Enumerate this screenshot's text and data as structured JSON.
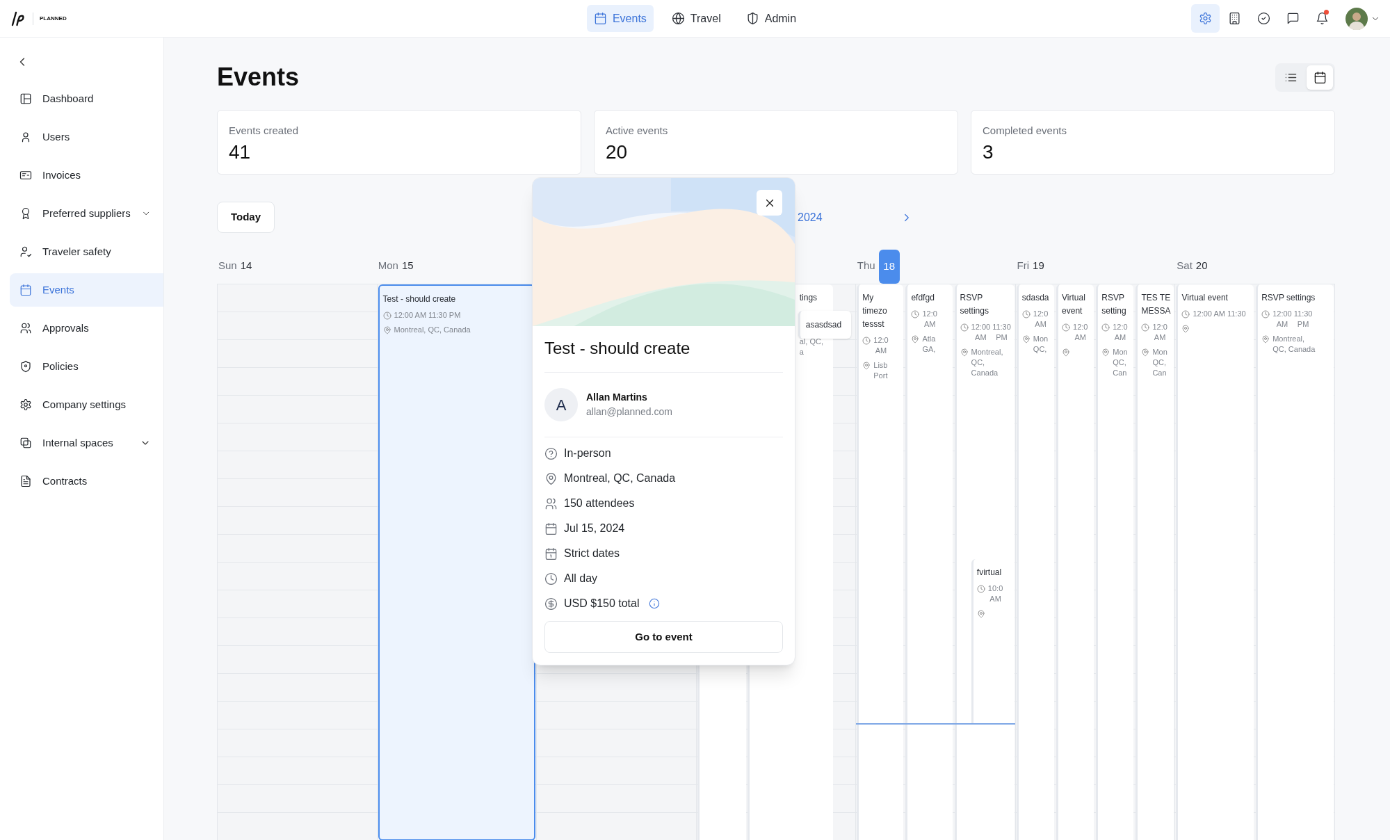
{
  "brand": {
    "wordmark": "PLANNED"
  },
  "top_nav": [
    {
      "label": "Events",
      "selected": true
    },
    {
      "label": "Travel",
      "selected": false
    },
    {
      "label": "Admin",
      "selected": false
    }
  ],
  "header_icons": [
    {
      "selected": true
    },
    {
      "selected": false
    },
    {
      "selected": false
    },
    {
      "selected": false
    },
    {
      "selected": false,
      "badge": true
    }
  ],
  "sidebar": {
    "items": [
      {
        "label": "Dashboard",
        "selected": false
      },
      {
        "label": "Users",
        "selected": false
      },
      {
        "label": "Invoices",
        "selected": false
      },
      {
        "label": "Preferred suppliers",
        "selected": false,
        "expandable": true
      },
      {
        "label": "Traveler safety",
        "selected": false
      },
      {
        "label": "Events",
        "selected": true
      },
      {
        "label": "Approvals",
        "selected": false
      },
      {
        "label": "Policies",
        "selected": false
      },
      {
        "label": "Company settings",
        "selected": false
      },
      {
        "label": "Internal spaces",
        "selected": false,
        "expandable": true
      },
      {
        "label": "Contracts",
        "selected": false
      }
    ]
  },
  "page": {
    "title": "Events",
    "views": [
      {
        "selected": false
      },
      {
        "selected": true
      }
    ]
  },
  "stats": [
    {
      "label": "Events created",
      "value": "41"
    },
    {
      "label": "Active events",
      "value": "20"
    },
    {
      "label": "Completed events",
      "value": "3"
    }
  ],
  "calendar": {
    "today_button": "Today",
    "range": "2024",
    "days": [
      {
        "kind": "day",
        "weekday": "Sun",
        "date": "14",
        "today": false
      },
      {
        "kind": "day",
        "weekday": "Mon",
        "date": "15",
        "today": false,
        "events": [
          {
            "kind": "allday",
            "selected": true,
            "title": [
              "Test - should create"
            ],
            "time": [
              [
                "12:00 AM"
              ],
              [
                "11:30 PM"
              ]
            ],
            "location": [
              "Montreal, QC, Canada"
            ]
          }
        ]
      },
      {
        "kind": "blank"
      },
      {
        "kind": "blank",
        "events": [
          {
            "kind": "covered",
            "selected": false
          },
          {
            "kind": "partial",
            "selected": false,
            "title": [
              "tings"
            ],
            "location": [
              "al, QC,",
              "a"
            ]
          },
          {
            "kind": "overlay",
            "selected": false,
            "title": [
              "asasdsad"
            ]
          }
        ]
      },
      {
        "kind": "day",
        "weekday": "Thu",
        "date": "18",
        "today": true,
        "events": [
          {
            "kind": "allday",
            "selected": false,
            "title": [
              "My",
              "timezo",
              "tessst"
            ],
            "time": [
              [
                "12:0",
                "AM"
              ]
            ],
            "location": [
              "Lisb",
              "Port"
            ]
          },
          {
            "kind": "allday",
            "selected": false,
            "title": [
              "efdfgd"
            ],
            "time": [
              [
                "12:0",
                "AM"
              ]
            ],
            "location": [
              "Atla",
              "GA,"
            ]
          },
          {
            "kind": "allday",
            "selected": false,
            "title": [
              "RSVP",
              "settings"
            ],
            "time": [
              [
                "12:00",
                "AM"
              ],
              [
                "11:30",
                "PM"
              ]
            ],
            "location": [
              "Montreal,",
              "QC,",
              "Canada"
            ]
          },
          {
            "kind": "timed",
            "selected": false,
            "title": [
              "fvirtual"
            ],
            "time": [
              [
                "10:0",
                "AM"
              ]
            ],
            "pin": true
          }
        ]
      },
      {
        "kind": "day",
        "weekday": "Fri",
        "date": "19",
        "today": false,
        "events": [
          {
            "kind": "allday",
            "selected": false,
            "title": [
              "sdasda"
            ],
            "time": [
              [
                "12:0",
                "AM"
              ]
            ],
            "location": [
              "Mon",
              "QC,"
            ]
          },
          {
            "kind": "allday",
            "selected": false,
            "title": [
              "Virtual",
              "event"
            ],
            "time": [
              [
                "12:0",
                "AM"
              ]
            ],
            "pin": true
          },
          {
            "kind": "allday",
            "selected": false,
            "title": [
              "RSVP",
              "setting"
            ],
            "time": [
              [
                "12:0",
                "AM"
              ]
            ],
            "location": [
              "Mon",
              "QC,",
              "Can"
            ]
          },
          {
            "kind": "allday",
            "selected": false,
            "title": [
              "TES TE",
              "MESSA"
            ],
            "time": [
              [
                "12:0",
                "AM"
              ]
            ],
            "location": [
              "Mon",
              "QC,",
              "Can"
            ]
          }
        ]
      },
      {
        "kind": "day",
        "weekday": "Sat",
        "date": "20",
        "today": false,
        "events": [
          {
            "kind": "allday",
            "selected": false,
            "title": [
              "Virtual event"
            ],
            "time": [
              [
                "12:00 AM"
              ],
              [
                "11:30"
              ]
            ],
            "pin": true
          },
          {
            "kind": "allday",
            "selected": false,
            "title": [
              "RSVP settings"
            ],
            "time": [
              [
                "12:00",
                "AM"
              ],
              [
                "11:30",
                "PM"
              ]
            ],
            "location": [
              "Montreal,",
              "QC, Canada"
            ]
          }
        ]
      }
    ]
  },
  "popover": {
    "title": "Test - should create",
    "organizer": {
      "initial": "A",
      "name": "Allan Martins",
      "email": "allan@planned.com"
    },
    "details": [
      {
        "text": "In-person"
      },
      {
        "text": "Montreal, QC, Canada"
      },
      {
        "text": "150 attendees"
      },
      {
        "text": "Jul 15, 2024"
      },
      {
        "text": "Strict dates"
      },
      {
        "text": "All day"
      },
      {
        "text": "USD $150 total",
        "info": true
      }
    ],
    "button": "Go to event"
  }
}
